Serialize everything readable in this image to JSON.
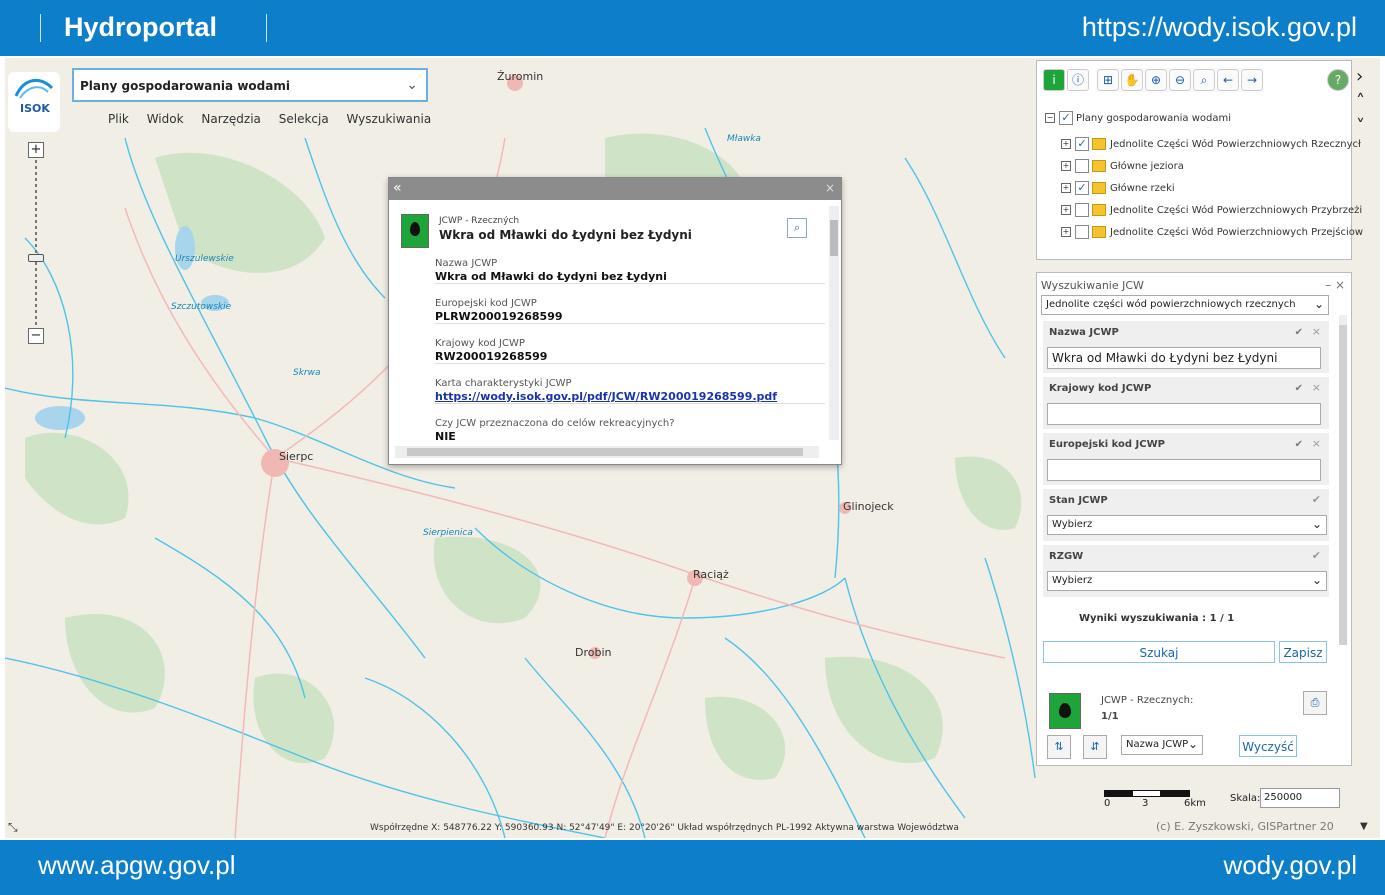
{
  "header": {
    "brand": "Hydroportal",
    "url": "https://wody.isok.gov.pl"
  },
  "footer": {
    "left": "www.apgw.gov.pl",
    "right": "wody.gov.pl"
  },
  "logo": {
    "text": "ISOK"
  },
  "theme_select": {
    "value": "Plany gospodarowania wodami"
  },
  "menu": [
    "Plik",
    "Widok",
    "Narzędzia",
    "Selekcja",
    "Wyszukiwania"
  ],
  "zoom": {
    "plus": "+",
    "minus": "−"
  },
  "map_labels": [
    {
      "text": "Żuromin",
      "kind": "town"
    },
    {
      "text": "Sierpc",
      "kind": "town"
    },
    {
      "text": "Raciąż",
      "kind": "town"
    },
    {
      "text": "Drobin",
      "kind": "town"
    },
    {
      "text": "Glinojeck",
      "kind": "town"
    },
    {
      "text": "Skrwa",
      "kind": "river"
    },
    {
      "text": "Sierpienica",
      "kind": "river"
    },
    {
      "text": "Mławka",
      "kind": "river"
    },
    {
      "text": "Urszulewskie",
      "kind": "river"
    },
    {
      "text": "Szczutowskie",
      "kind": "river"
    }
  ],
  "popup": {
    "collapse": "«",
    "close": "×",
    "subtitle": "JCWP - Rzeczných",
    "title": "Wkra od Mławki do Łydyni bez Łydyni",
    "fields": [
      {
        "label": "Nazwa JCWP",
        "value": "Wkra od Mławki do Łydyni bez Łydyni"
      },
      {
        "label": "Europejski kod JCWP",
        "value": "PLRW200019268599"
      },
      {
        "label": "Krajowy kod JCWP",
        "value": "RW200019268599"
      },
      {
        "label": "Karta charakterystyki JCWP",
        "value": "https://wody.isok.gov.pl/pdf/JCW/RW200019268599.pdf"
      },
      {
        "label": "Czy JCW przeznaczona do celów rekreacyjnych?",
        "value": "NIE"
      }
    ]
  },
  "layers": {
    "group": "Plany gospodarowania wodami",
    "items": [
      {
        "label": "Jednolite Części Wód Powierzchniowych Rzecznycł",
        "checked": true
      },
      {
        "label": "Główne jeziora",
        "checked": false
      },
      {
        "label": "Główne rzeki",
        "checked": true
      },
      {
        "label": "Jednolite Części Wód Powierzchniowych Przybrzeżi",
        "checked": false
      },
      {
        "label": "Jednolite Części Wód Powierzchniowych Przejściow",
        "checked": false
      }
    ]
  },
  "search": {
    "title": "Wyszukiwanie JCW",
    "type_select": "Jednolite części wód powierzchniowych rzecznych",
    "groups": [
      {
        "label": "Nazwa JCWP",
        "value": "Wkra od Mławki do Łydyni bez Łydyni"
      },
      {
        "label": "Krajowy kod JCWP",
        "value": ""
      },
      {
        "label": "Europejski kod JCWP",
        "value": ""
      }
    ],
    "stan_label": "Stan JCWP",
    "stan_value": "Wybierz",
    "rzgw_label": "RZGW",
    "rzgw_value": "Wybierz",
    "results": "Wyniki wyszukiwania : 1 / 1",
    "search_btn": "Szukaj",
    "save_btn": "Zapisz",
    "result_type": "JCWP - Rzecznych:",
    "result_count": "1/1",
    "sort_select": "Nazwa JCWP",
    "clear_btn": "Wyczyść"
  },
  "status": {
    "text": "Współrzędne X: 548776.22 Y: 590360.93   N: 52°47'49\" E: 20°20'26\"   Układ współrzędnych PL-1992   Aktywna warstwa Województwa"
  },
  "scale": {
    "label": "Skala:",
    "value": "250000",
    "ticks": [
      "0",
      "3",
      "6km"
    ]
  },
  "copyright": "(c) E. Zyszkowski, GISPartner 20"
}
